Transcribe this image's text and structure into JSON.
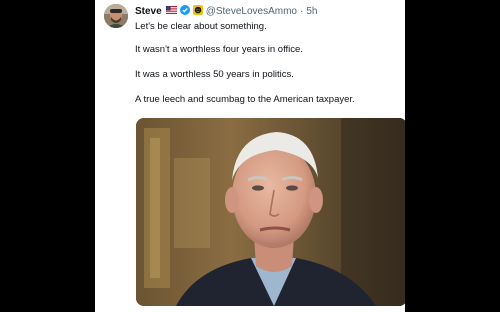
{
  "author": {
    "display_name": "Steve",
    "handle": "@SteveLovesAmmo",
    "separator": "·",
    "time": "5h",
    "badges": [
      "us-flag-icon",
      "verified-badge-icon",
      "smiley-badge-icon"
    ]
  },
  "tweet": {
    "lines": [
      "Let's be clear about something.",
      "It wasn't a worthless four years in office.",
      "It was a worthless 50 years in politics.",
      "A true leech and scumbag to the American taxpayer."
    ]
  },
  "media": {
    "type": "photo",
    "subject": "portrait of older man with white hair, dark suit, light blue shirt"
  },
  "colors": {
    "page_bg": "#000000",
    "card_bg": "#ffffff",
    "text_primary": "#0f1419",
    "text_secondary": "#536471",
    "verified": "#1d9bf0"
  }
}
